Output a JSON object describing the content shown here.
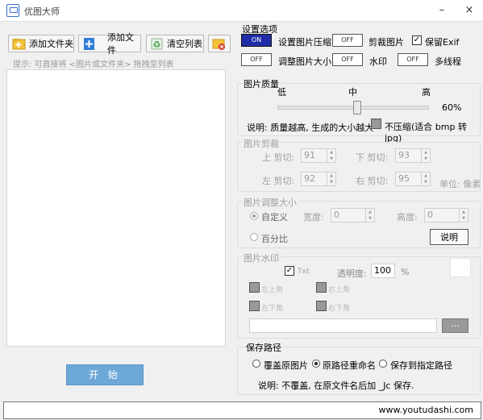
{
  "window": {
    "title": "优图大师",
    "minimize": "–",
    "close": "×"
  },
  "toolbar": {
    "add_folder": "添加文件夹",
    "add_file": "添加文件",
    "clear_list": "清空列表"
  },
  "hint": "提示: 可直接将 <图片或文件夹> 拖拽至列表",
  "start_button": "开 始",
  "settings": {
    "title": "设置选项",
    "options": [
      {
        "toggle": "ON",
        "label": "设置图片压缩"
      },
      {
        "toggle": "OFF",
        "label": "剪裁图片"
      },
      {
        "toggle": "OFF",
        "label": "调整图片大小"
      },
      {
        "toggle": "OFF",
        "label": "水印"
      },
      {
        "toggle": "OFF",
        "label": "多线程"
      }
    ],
    "keep_exif": "保留Exif"
  },
  "quality": {
    "title": "图片质量",
    "low": "低",
    "mid": "中",
    "high": "高",
    "value": "60%",
    "level": 0.6,
    "note": "说明: 质量越高, 生成的大小越大",
    "no_compress": "不压缩(适合 bmp 转 jpg)"
  },
  "crop": {
    "title": "图片剪裁",
    "top_label": "上 剪切:",
    "top_value": "91",
    "bottom_label": "下 剪切:",
    "bottom_value": "93",
    "left_label": "左 剪切:",
    "left_value": "92",
    "right_label": "右 剪切:",
    "right_value": "95",
    "unit": "单位: 像素"
  },
  "resize": {
    "title": "图片调整大小",
    "custom": "自定义",
    "width_label": "宽度:",
    "width_value": "0",
    "height_label": "高度:",
    "height_value": "0",
    "percent": "百分比",
    "explain_button": "说明"
  },
  "watermark": {
    "title": "图片水印",
    "text_tag": "Txt",
    "opacity_label": "透明度:",
    "opacity_value": "100",
    "percent_sign": "%",
    "positions": [
      "左上角",
      "右上角",
      "左下角",
      "右下角"
    ],
    "browse": "..."
  },
  "save": {
    "title": "保存路径",
    "options": [
      "覆盖原图片",
      "原路径重命名",
      "保存到指定路径"
    ],
    "note": "说明: 不覆盖, 在原文件名后加 _Jc 保存."
  },
  "status": {
    "site": "www.youtudashi.com"
  }
}
